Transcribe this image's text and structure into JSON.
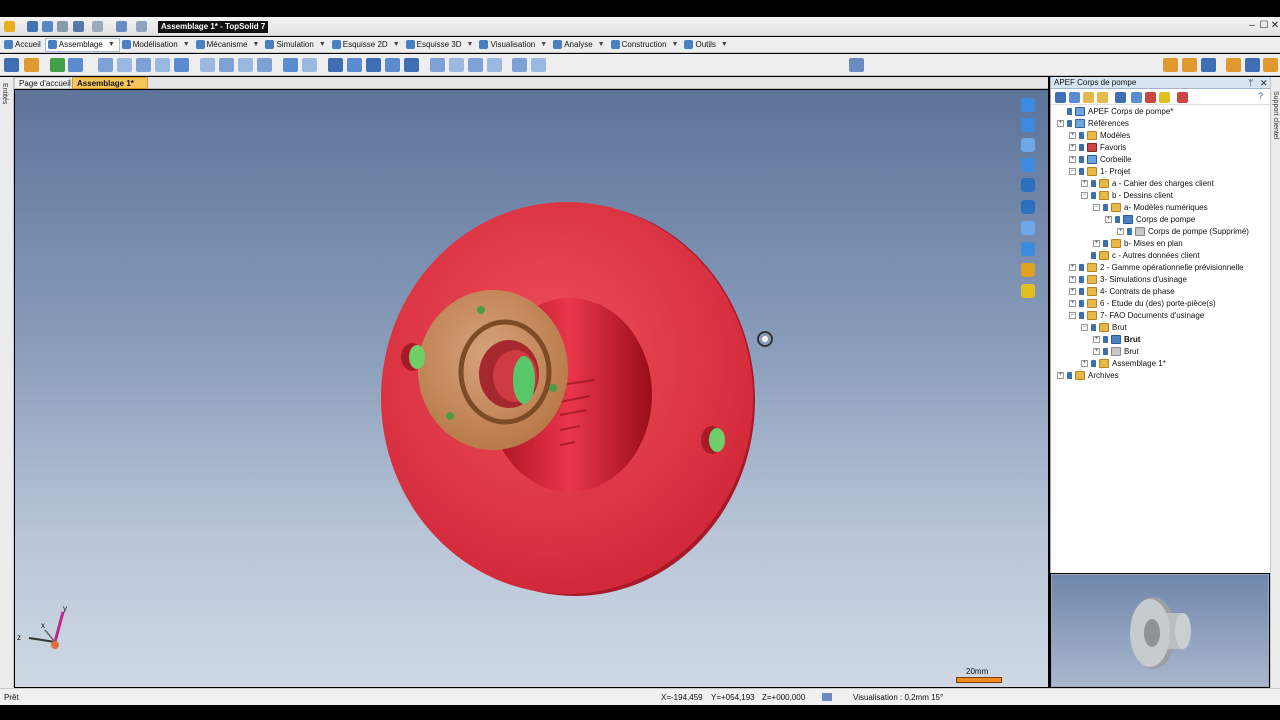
{
  "window": {
    "title": "Assemblage 1* - TopSolid 7",
    "controls": [
      "–",
      "☐",
      "✕"
    ]
  },
  "menu": {
    "items": [
      {
        "label": "Accueil",
        "active": false,
        "icon": "home-icon"
      },
      {
        "label": "Assemblage",
        "active": true,
        "icon": "assembly-icon"
      },
      {
        "label": "Modélisation",
        "active": false,
        "icon": "modeling-icon"
      },
      {
        "label": "Mécanisme",
        "active": false,
        "icon": "mechanism-icon"
      },
      {
        "label": "Simulation",
        "active": false,
        "icon": "simulation-icon"
      },
      {
        "label": "Esquisse 2D",
        "active": false,
        "icon": "sketch2d-icon"
      },
      {
        "label": "Esquisse 3D",
        "active": false,
        "icon": "sketch3d-icon"
      },
      {
        "label": "Visualisation",
        "active": false,
        "icon": "visualisation-icon"
      },
      {
        "label": "Analyse",
        "active": false,
        "icon": "analysis-icon"
      },
      {
        "label": "Construction",
        "active": false,
        "icon": "construction-icon"
      },
      {
        "label": "Outils",
        "active": false,
        "icon": "tools-icon"
      }
    ]
  },
  "tabs": {
    "home": "Page d'accueil",
    "active": "Assemblage 1*"
  },
  "left_strip": {
    "label": "Entités"
  },
  "right_strip": {
    "label": "Support clientel"
  },
  "viewport": {
    "scale_label": "20mm",
    "axis": {
      "x": "x",
      "y": "y",
      "z": "z"
    },
    "colors": {
      "flange": "#e0343f",
      "ring": "#c98d5e",
      "hole": "#6fd06a",
      "scale": "#f08a1c"
    }
  },
  "panel": {
    "title": "APEF Corps de pompe",
    "pin": "ᛘ",
    "close": "✕",
    "help": "?",
    "tree": [
      {
        "label": "APEF Corps de pompe*",
        "level": 0,
        "icon": "proj",
        "exp": "",
        "bold": false
      },
      {
        "label": "Références",
        "level": 0,
        "icon": "proj",
        "exp": "+",
        "bold": false
      },
      {
        "label": "Modèles",
        "level": 1,
        "icon": "folder",
        "exp": "+",
        "bold": false
      },
      {
        "label": "Favoris",
        "level": 1,
        "icon": "red",
        "exp": "+",
        "bold": false
      },
      {
        "label": "Corbeille",
        "level": 1,
        "icon": "proj",
        "exp": "+",
        "bold": false
      },
      {
        "label": "1- Projet",
        "level": 1,
        "icon": "folder",
        "exp": "−",
        "bold": false
      },
      {
        "label": "a - Cahier des charges client",
        "level": 2,
        "icon": "folder",
        "exp": "+",
        "bold": false
      },
      {
        "label": "b - Dessins client",
        "level": 2,
        "icon": "folder",
        "exp": "−",
        "bold": false
      },
      {
        "label": "a- Modèles numériques",
        "level": 3,
        "icon": "folder",
        "exp": "−",
        "bold": false
      },
      {
        "label": "Corps de pompe",
        "level": 4,
        "icon": "part",
        "exp": "+",
        "bold": false
      },
      {
        "label": "Corps de pompe (Supprimé)",
        "level": 5,
        "icon": "gray",
        "exp": "+",
        "bold": false
      },
      {
        "label": "b- Mises en plan",
        "level": 3,
        "icon": "folder",
        "exp": "+",
        "bold": false
      },
      {
        "label": "c - Autres données client",
        "level": 2,
        "icon": "folder",
        "exp": "",
        "bold": false
      },
      {
        "label": "2 - Gamme opérationnelle prévisionnelle",
        "level": 1,
        "icon": "folder",
        "exp": "+",
        "bold": false
      },
      {
        "label": "3- Simulations d'usinage",
        "level": 1,
        "icon": "folder",
        "exp": "+",
        "bold": false
      },
      {
        "label": "4- Contrats de phase",
        "level": 1,
        "icon": "folder",
        "exp": "+",
        "bold": false
      },
      {
        "label": "6 - Etude du (des) porte-pièce(s)",
        "level": 1,
        "icon": "folder",
        "exp": "+",
        "bold": false
      },
      {
        "label": "7- FAO Documents d'usinage",
        "level": 1,
        "icon": "folder",
        "exp": "−",
        "bold": false
      },
      {
        "label": "Brut",
        "level": 2,
        "icon": "folder",
        "exp": "−",
        "bold": false
      },
      {
        "label": "Brut",
        "level": 3,
        "icon": "part",
        "exp": "+",
        "bold": true
      },
      {
        "label": "Brut",
        "level": 3,
        "icon": "gray",
        "exp": "+",
        "bold": false
      },
      {
        "label": "Assemblage 1*",
        "level": 2,
        "icon": "folder",
        "exp": "+",
        "bold": false
      },
      {
        "label": "Archives",
        "level": 0,
        "icon": "folder",
        "exp": "+",
        "bold": false
      }
    ]
  },
  "status": {
    "state": "Prêt",
    "x": "X=-194,459",
    "y": "Y=+054,193",
    "z": "Z=+000,000",
    "visualisation": "Visualisation : 0,2mm 15°"
  }
}
